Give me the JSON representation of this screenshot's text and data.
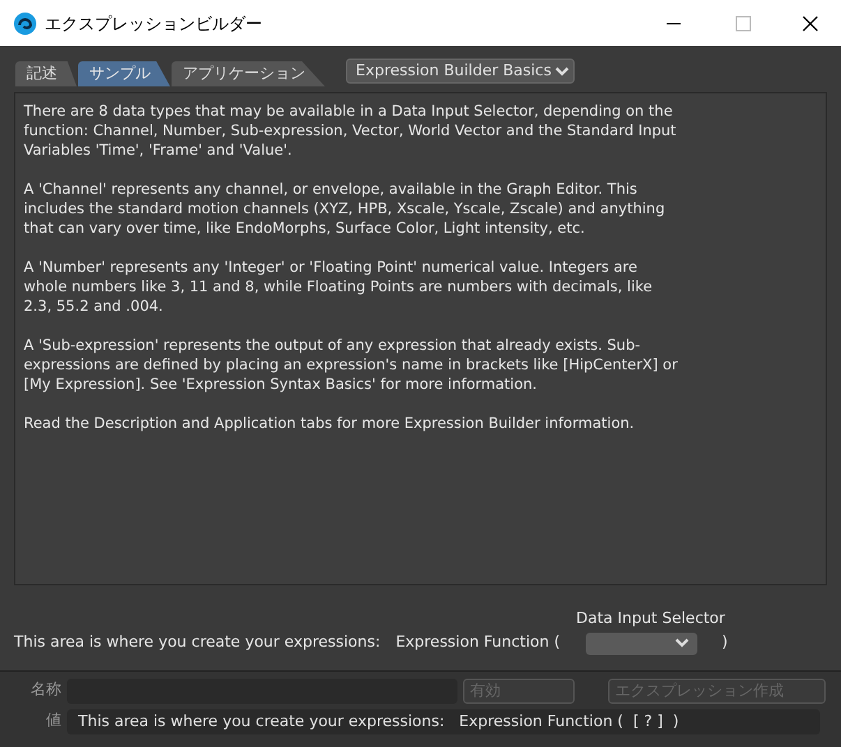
{
  "window": {
    "title": "エクスプレッションビルダー"
  },
  "tabs": [
    {
      "label": "記述",
      "selected": false
    },
    {
      "label": "サンプル",
      "selected": true
    },
    {
      "label": "アプリケーション",
      "selected": false
    }
  ],
  "topic_select": {
    "value": "Expression Builder Basics"
  },
  "paragraphs": [
    "There are 8 data types that may be available in a Data Input Selector, depending on the function: Channel, Number, Sub-expression, Vector, World Vector and the Standard Input Variables 'Time', 'Frame' and 'Value'.",
    "A 'Channel' represents any channel, or envelope, available in the Graph Editor. This includes the standard motion channels (XYZ, HPB, Xscale, Yscale, Zscale) and anything that can vary over time, like EndoMorphs, Surface Color, Light intensity, etc.",
    "A 'Number' represents any 'Integer' or 'Floating Point' numerical value. Integers are whole numbers like 3, 11 and 8, while Floating Points are numbers with decimals, like 2.3, 55.2 and .004.",
    "A 'Sub-expression' represents the output of any expression that already exists. Sub-expressions are defined by placing an expression's name in brackets like [HipCenterX] or [My Expression]. See 'Expression Syntax Basics' for more information.",
    "Read the Description and Application tabs for more Expression Builder information."
  ],
  "builder": {
    "intro": "This area is where you create your expressions:",
    "function_label": "Expression Function (",
    "selector_label": "Data Input Selector",
    "close_paren": ")"
  },
  "name_row": {
    "label": "名称",
    "enable_button": {
      "label": "有効",
      "disabled": true
    },
    "create_button": {
      "label": "エクスプレッション作成",
      "disabled": true
    }
  },
  "value_row": {
    "label": "値",
    "value": "This area is where you create your expressions:   Expression Function (  [ ? ]  )"
  }
}
